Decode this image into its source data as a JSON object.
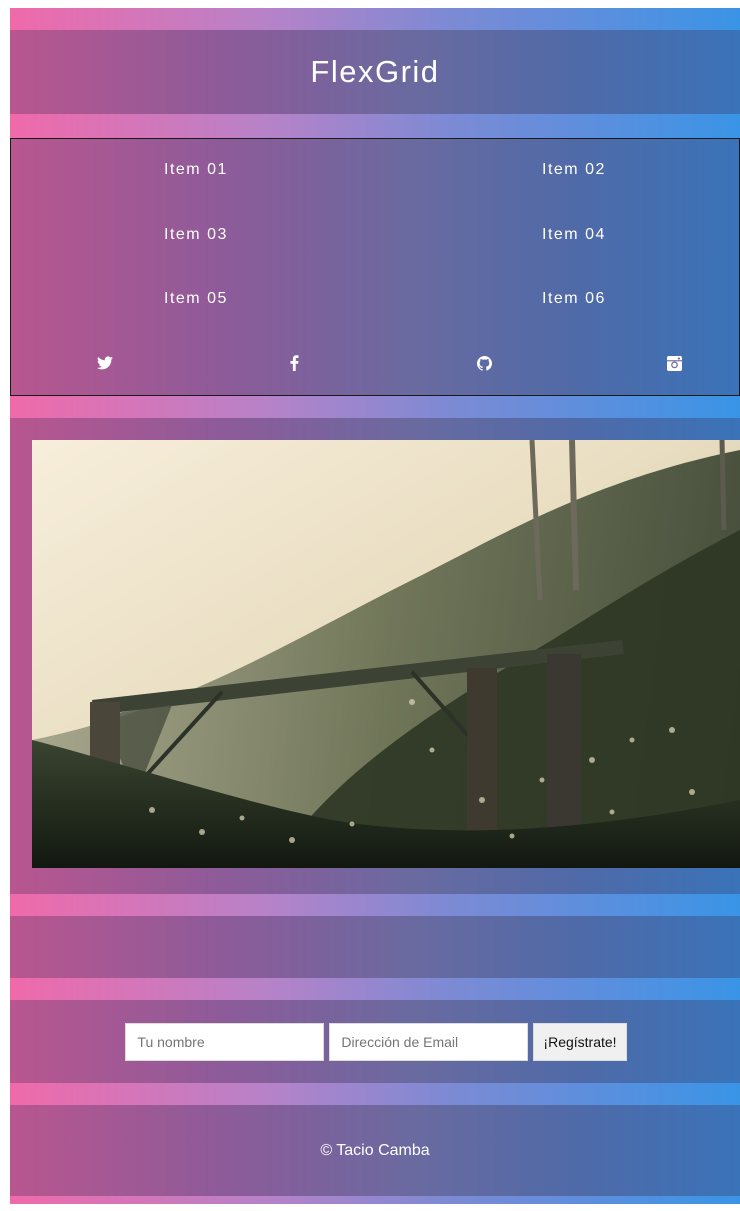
{
  "header": {
    "title": "FlexGrid"
  },
  "nav": {
    "items": [
      {
        "label": "Item 01"
      },
      {
        "label": "Item 02"
      },
      {
        "label": "Item 03"
      },
      {
        "label": "Item 04"
      },
      {
        "label": "Item 05"
      },
      {
        "label": "Item 06"
      }
    ],
    "social": [
      "twitter-icon",
      "facebook-icon",
      "github-icon",
      "instagram-icon"
    ]
  },
  "form": {
    "name_placeholder": "Tu nombre",
    "email_placeholder": "Dirección de Email",
    "submit_label": "¡Regístrate!"
  },
  "footer": {
    "copyright": "© Tacio Camba"
  },
  "colors": {
    "band_left": "#b8568f",
    "band_right": "#3a73b8",
    "stripe_left": "#f06aaa",
    "stripe_right": "#3a94e6"
  }
}
